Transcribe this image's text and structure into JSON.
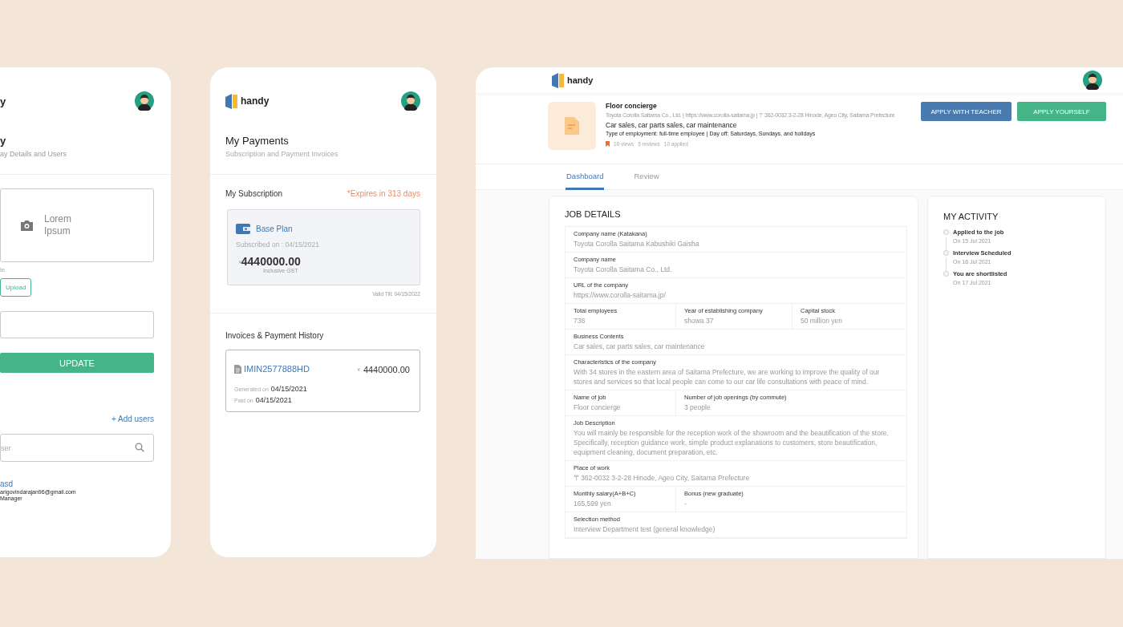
{
  "company_screen": {
    "logo_text": "y",
    "title": "y",
    "subtitle": "ay Details and Users",
    "upload_box": {
      "label": "Lorem Ipsum"
    },
    "file_hint": "le",
    "upload_button": "Upload",
    "update_button": "UPDATE",
    "add_users_link": "+ Add users",
    "search": {
      "placeholder": "ser"
    },
    "users": [
      {
        "name": "asd",
        "email": "arigovindarajan96@gmail.com",
        "role": "Manager"
      }
    ]
  },
  "payments_screen": {
    "logo_text": "handy",
    "title": "My Payments",
    "subtitle": "Subscription and Payment Invoices",
    "subscription": {
      "heading": "My  Subscription",
      "expiry": "*Expires in 313 days",
      "plan": "Base Plan",
      "subscribed_on": "Subscribed on : 04/15/2021",
      "currency": "¥",
      "amount": "4440000.00",
      "tax_note": "Inclusive GST",
      "valid_till": "Valid Till: 04/15/2022"
    },
    "history": {
      "heading": "Invoices & Payment History",
      "invoices": [
        {
          "number": "IMIN2577888HD",
          "currency": "¥",
          "amount": "4440000.00",
          "generated_label": "Generated on",
          "generated": "04/15/2021",
          "paid_label": "Paid on",
          "paid": "04/15/2021"
        }
      ]
    }
  },
  "job_screen": {
    "logo_text": "handy",
    "job": {
      "title": "Floor concierge",
      "company_line": "Toyota Corolla Saitama Co., Ltd. | https://www.corolla-saitama.jp | 〒362-0032 3-2-28 Hinode, Ageo City, Saitama Prefecture",
      "tags": "Car sales, car parts sales, car maintenance",
      "employment": "Type of employment: full-time employee | Day off: Saturdays, Sundays, and holidays",
      "stats": [
        "10 views",
        "5 reviews",
        "10 applied"
      ]
    },
    "actions": [
      {
        "label": "APPLY WITH TEACHER",
        "kind": "secondary"
      },
      {
        "label": "APPLY YOURSELF",
        "kind": "primary"
      }
    ],
    "tabs": [
      {
        "label": "Dashboard",
        "selected": true
      },
      {
        "label": "Review",
        "selected": false
      }
    ],
    "details": {
      "heading": "JOB DETAILS",
      "rows": [
        [
          {
            "label": "Company name (Katakana)",
            "value": "Toyota Corolla Saitama Kabushiki Gaisha"
          }
        ],
        [
          {
            "label": "Company name",
            "value": "Toyota Corolla Saitama Co., Ltd."
          }
        ],
        [
          {
            "label": "URL of the company",
            "value": "https://www.corolla-saitama.jp/"
          }
        ],
        [
          {
            "label": "Total employees",
            "value": "738"
          },
          {
            "label": "Year of establishing company",
            "value": "showa 37"
          },
          {
            "label": "Capital stock",
            "value": "50 million yen"
          }
        ],
        [
          {
            "label": "Business Contents",
            "value": "Car sales, car parts sales, car maintenance"
          }
        ],
        [
          {
            "label": "Characteristics of the company",
            "value": "With 34 stores in the eastern area of Saitama Prefecture, we are working to improve the quality of our stores and services so that local people can come to our car life consultations with peace of mind."
          }
        ],
        [
          {
            "label": "Name of job",
            "value": "Floor concierge"
          },
          {
            "label": "Number of job openings (by commute)",
            "value": "3 people"
          }
        ],
        [
          {
            "label": "Job Description",
            "value": "You will mainly be responsible for the reception work of the showroom and the beautification of the store. Specifically, reception guidance work, simple product explanations to customers, store beautification, equipment cleaning, document preparation, etc."
          }
        ],
        [
          {
            "label": "Place of work",
            "value": "〒362-0032 3-2-28 Hinode, Ageo City, Saitama Prefecture"
          }
        ],
        [
          {
            "label": "Monthly salary(A+B+C)",
            "value": "165,599 yen"
          },
          {
            "label": "Bonus (new graduate)",
            "value": "-"
          }
        ],
        [
          {
            "label": "Selection method",
            "value": "Interview Department test (general knowledge)"
          }
        ]
      ]
    },
    "activity": {
      "heading": "MY ACTIVITY",
      "items": [
        {
          "title": "Applied to the job",
          "date": "On 15 Jul 2021"
        },
        {
          "title": "Interview Scheduled",
          "date": "On 16 Jul 2021"
        },
        {
          "title": "You are shortlisted",
          "date": "On 17 Jul 2021"
        }
      ]
    }
  }
}
